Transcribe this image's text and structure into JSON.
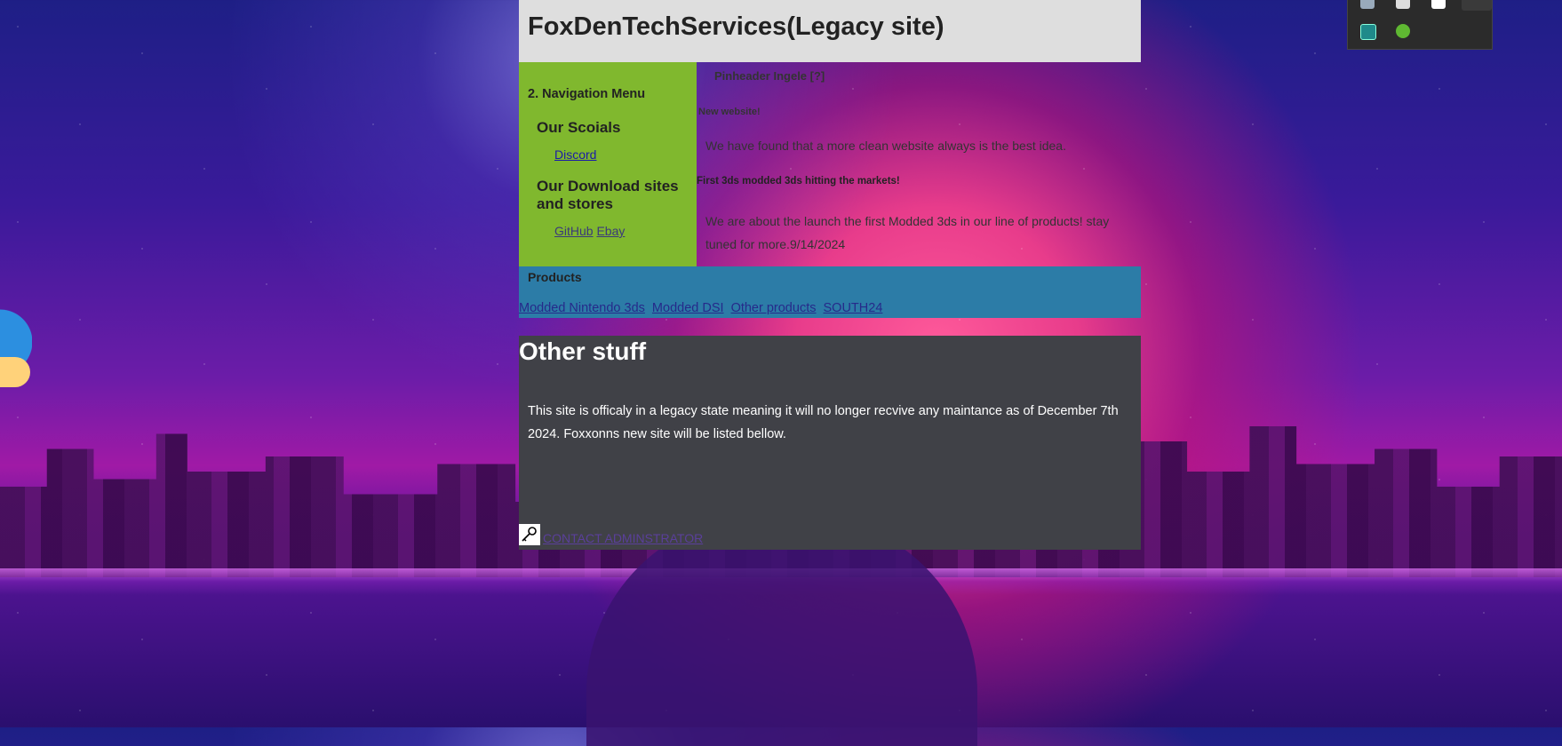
{
  "site": {
    "title": "FoxDenTechServices(Legacy site)",
    "nav": {
      "heading": "2. Navigation Menu",
      "socials_heading": "Our Scoials",
      "socials_links": [
        "Discord"
      ],
      "downloads_heading": "Our Download sites and stores",
      "download_links": [
        "GitHub",
        "Ebay"
      ]
    },
    "content": {
      "heading1": "Pinheader Ingele [?]",
      "heading2": "New website!",
      "paragraph1": "We have found that a more clean website always is the best idea.",
      "heading3": "First 3ds modded 3ds hitting the markets!",
      "paragraph2": "We are about the launch the first Modded 3ds in our line of products! stay tuned for more.9/14/2024"
    },
    "products": {
      "title": "Products",
      "links": [
        "Modded Nintendo 3ds",
        "Modded DSI",
        "Other products",
        "SOUTH24"
      ]
    },
    "other": {
      "title": "Other stuff",
      "text": "This site is officaly in a legacy state meaning it will no longer recvive any maintance as of December 7th 2024. Foxxonns new site will be listed bellow.",
      "contact_label": "CONTACT ADMINSTRATOR",
      "contact_icon": "key-icon"
    },
    "colors": {
      "header_bg": "#dedede",
      "nav_bg": "#80b82e",
      "products_bg": "#2c7ca7",
      "other_bg": "#404147"
    }
  },
  "tray": {
    "icons": [
      "app-icon",
      "ai-icon",
      "shield-check-icon"
    ]
  }
}
